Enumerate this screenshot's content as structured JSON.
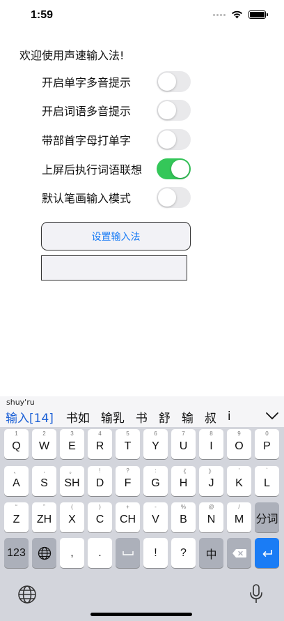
{
  "status": {
    "time": "1:59"
  },
  "welcome": "欢迎使用声速输入法!",
  "settings": [
    {
      "label": "开启单字多音提示",
      "on": false
    },
    {
      "label": "开启词语多音提示",
      "on": false
    },
    {
      "label": "带部首字母打单字",
      "on": false
    },
    {
      "label": "上屏后执行词语联想",
      "on": true
    },
    {
      "label": "默认笔画输入模式",
      "on": false
    }
  ],
  "setup_button": "设置输入法",
  "text_field_value": "",
  "colors": {
    "accent": "#1a7cf5",
    "toggle_on": "#34c759",
    "toggle_off": "#e9e9eb",
    "keyboard_bg": "#d3d5dc"
  },
  "keyboard": {
    "pinyin": "shuy'ru",
    "candidates": [
      "输入[14]",
      "书如",
      "输乳",
      "书",
      "舒",
      "输",
      "叔",
      "i"
    ],
    "row1": [
      {
        "hint": "1",
        "label": "Q"
      },
      {
        "hint": "2",
        "label": "W"
      },
      {
        "hint": "3",
        "label": "E"
      },
      {
        "hint": "4",
        "label": "R"
      },
      {
        "hint": "5",
        "label": "T"
      },
      {
        "hint": "6",
        "label": "Y"
      },
      {
        "hint": "7",
        "label": "U"
      },
      {
        "hint": "8",
        "label": "I"
      },
      {
        "hint": "9",
        "label": "O"
      },
      {
        "hint": "0",
        "label": "P"
      }
    ],
    "row2": [
      {
        "hint": "、",
        "label": "A"
      },
      {
        "hint": ",",
        "label": "S"
      },
      {
        "hint": "。",
        "label": "SH"
      },
      {
        "hint": "!",
        "label": "D"
      },
      {
        "hint": "?",
        "label": "F"
      },
      {
        "hint": ":",
        "label": "G"
      },
      {
        "hint": "《",
        "label": "H"
      },
      {
        "hint": "》",
        "label": "J"
      },
      {
        "hint": "'",
        "label": "K"
      },
      {
        "hint": "`",
        "label": "L"
      }
    ],
    "row3": [
      {
        "hint": "“",
        "label": "Z"
      },
      {
        "hint": "”",
        "label": "ZH"
      },
      {
        "hint": "(",
        "label": "X"
      },
      {
        "hint": ")",
        "label": "C"
      },
      {
        "hint": "+",
        "label": "CH"
      },
      {
        "hint": "-",
        "label": "V"
      },
      {
        "hint": "%",
        "label": "B"
      },
      {
        "hint": "@",
        "label": "N"
      },
      {
        "hint": "/",
        "label": "M"
      }
    ],
    "segment_key": "分词",
    "numbers_key": "123",
    "comma_key": ",",
    "period_key": ".",
    "exclaim_key": "!",
    "question_key": "?",
    "chinese_key": "中"
  }
}
